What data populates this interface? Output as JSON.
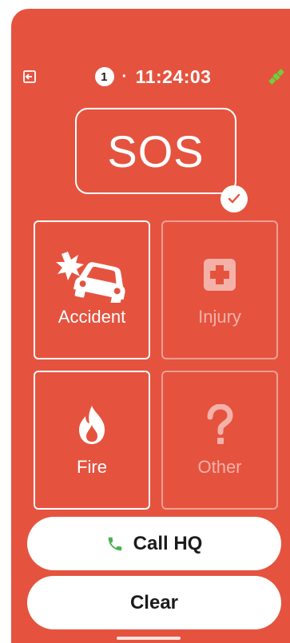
{
  "status": {
    "count": "1",
    "separator": "·",
    "time": "11:24:03"
  },
  "sos": {
    "label": "SOS"
  },
  "tiles": {
    "accident": "Accident",
    "injury": "Injury",
    "fire": "Fire",
    "other": "Other"
  },
  "buttons": {
    "call_hq": "Call HQ",
    "clear": "Clear"
  },
  "icons": {
    "exit": "exit-icon",
    "satellite": "satellite-icon",
    "check": "check-icon",
    "car_crash": "car-crash-icon",
    "first_aid": "first-aid-icon",
    "fire": "fire-icon",
    "question": "question-icon",
    "phone": "phone-icon"
  },
  "colors": {
    "background": "#e5533f",
    "accent_green": "#4caf50",
    "satellite_green": "#6fcf3a",
    "text_dark": "#1b1b1b"
  }
}
